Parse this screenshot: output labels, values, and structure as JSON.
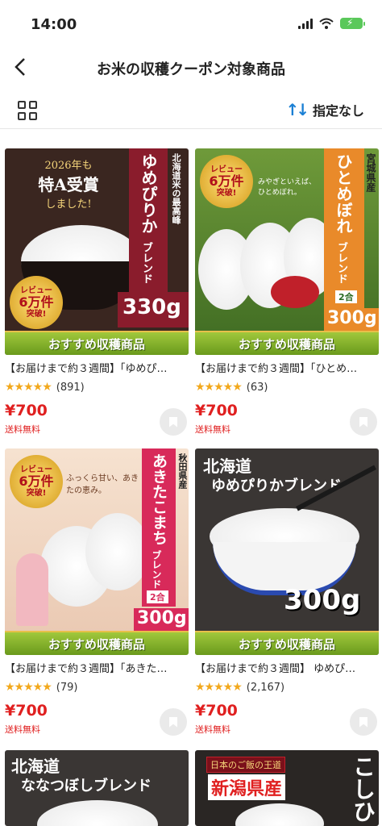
{
  "status": {
    "time": "14:00"
  },
  "nav": {
    "title": "お米の収穫クーポン対象商品"
  },
  "toolbar": {
    "sort_label": "指定なし"
  },
  "banner_text": "おすすめ収穫商品",
  "products": [
    {
      "name": "【お届けまで約３週間】「ゆめぴ…",
      "stars": "★★★★★",
      "review_count": "(891)",
      "price": "¥700",
      "shipping": "送料無料",
      "img": {
        "brand": "ゆめぴりか",
        "sub": "ブレンド",
        "origin": "北海道米の最高峰",
        "weight": "330g",
        "badge_top": "2026年も",
        "badge_main": "特A受賞",
        "badge_bottom": "しました!",
        "medal_top": "レビュー",
        "medal_main": "6万件",
        "medal_bottom": "突破!"
      }
    },
    {
      "name": "【お届けまで約３週間】「ひとめ…",
      "stars": "★★★★★",
      "review_count": "(63)",
      "price": "¥700",
      "shipping": "送料無料",
      "img": {
        "brand": "ひとめぼれ",
        "sub": "ブレンド",
        "origin": "宮城県産",
        "weight": "300g",
        "weight_prefix": "2合",
        "catch": "みやぎといえば、ひとめぼれ。",
        "medal_top": "レビュー",
        "medal_main": "6万件",
        "medal_bottom": "突破!"
      }
    },
    {
      "name": "【お届けまで約３週間】「あきた…",
      "stars": "★★★★★",
      "review_count": "(79)",
      "price": "¥700",
      "shipping": "送料無料",
      "img": {
        "brand": "あきたこまち",
        "sub": "ブレンド",
        "origin": "秋田県産",
        "weight": "300g",
        "weight_prefix": "2合",
        "catch": "ふっくら甘い、あきたの恵み。",
        "medal_top": "レビュー",
        "medal_main": "6万件",
        "medal_bottom": "突破!"
      }
    },
    {
      "name": "【お届けまで約３週間】 ゆめぴ…",
      "stars": "★★★★★",
      "review_count": "(2,167)",
      "price": "¥700",
      "shipping": "送料無料",
      "img": {
        "line1": "北海道",
        "line2": "ゆめぴりかブレンド",
        "weight": "300g"
      }
    },
    {
      "img": {
        "line1": "北海道",
        "line2": "ななつぼしブレンド"
      }
    },
    {
      "img": {
        "top": "日本のご飯の王道",
        "main": "新潟県産",
        "side": "こしひ"
      }
    }
  ]
}
